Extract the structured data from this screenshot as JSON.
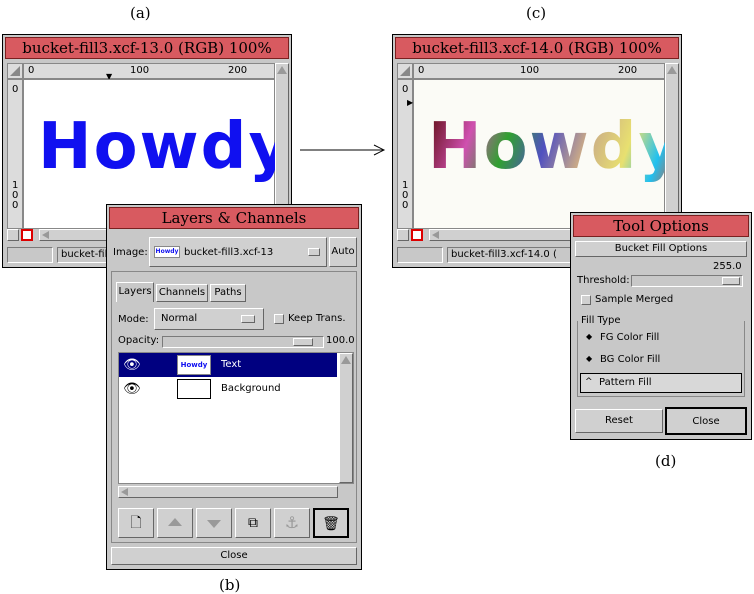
{
  "captions": {
    "a": "(a)",
    "b": "(b)",
    "c": "(c)",
    "d": "(d)"
  },
  "window_a": {
    "title": "bucket-fill3.xcf-13.0 (RGB) 100%",
    "ruler_ticks": [
      "0",
      "100",
      "200"
    ],
    "vruler_ticks": [
      "0",
      "1",
      "0",
      "0"
    ],
    "canvas_text": "Howdy",
    "status": "bucket-fil"
  },
  "window_c": {
    "title": "bucket-fill3.xcf-14.0 (RGB) 100%",
    "ruler_ticks": [
      "0",
      "100",
      "200"
    ],
    "vruler_ticks": [
      "0",
      "1",
      "0",
      "0"
    ],
    "canvas_text": "Howdy",
    "status": "bucket-fill3.xcf-14.0 ("
  },
  "layers": {
    "title": "Layers & Channels",
    "image_label": "Image:",
    "image_thumb": "Howdy",
    "image_value": "bucket-fill3.xcf-13",
    "auto": "Auto",
    "tabs": [
      "Layers",
      "Channels",
      "Paths"
    ],
    "mode_label": "Mode:",
    "mode_value": "Normal",
    "keep_trans": "Keep Trans.",
    "opacity_label": "Opacity:",
    "opacity_value": "100.0",
    "rows": [
      {
        "name": "Text",
        "thumb": "Howdy"
      },
      {
        "name": "Background",
        "thumb": ""
      }
    ],
    "close": "Close"
  },
  "tool_options": {
    "title": "Tool Options",
    "header": "Bucket Fill Options",
    "threshold_label": "Threshold:",
    "threshold_value": "255.0",
    "threshold_fraction": 1.0,
    "sample_merged": "Sample Merged",
    "fill_type": "Fill Type",
    "options": [
      "FG Color Fill",
      "BG Color Fill",
      "Pattern Fill"
    ],
    "selected": 2,
    "reset": "Reset",
    "close": "Close"
  },
  "colors": {
    "titlebar": "#d85a60",
    "selection": "#000080",
    "howdy_blue": "#1010f0"
  }
}
